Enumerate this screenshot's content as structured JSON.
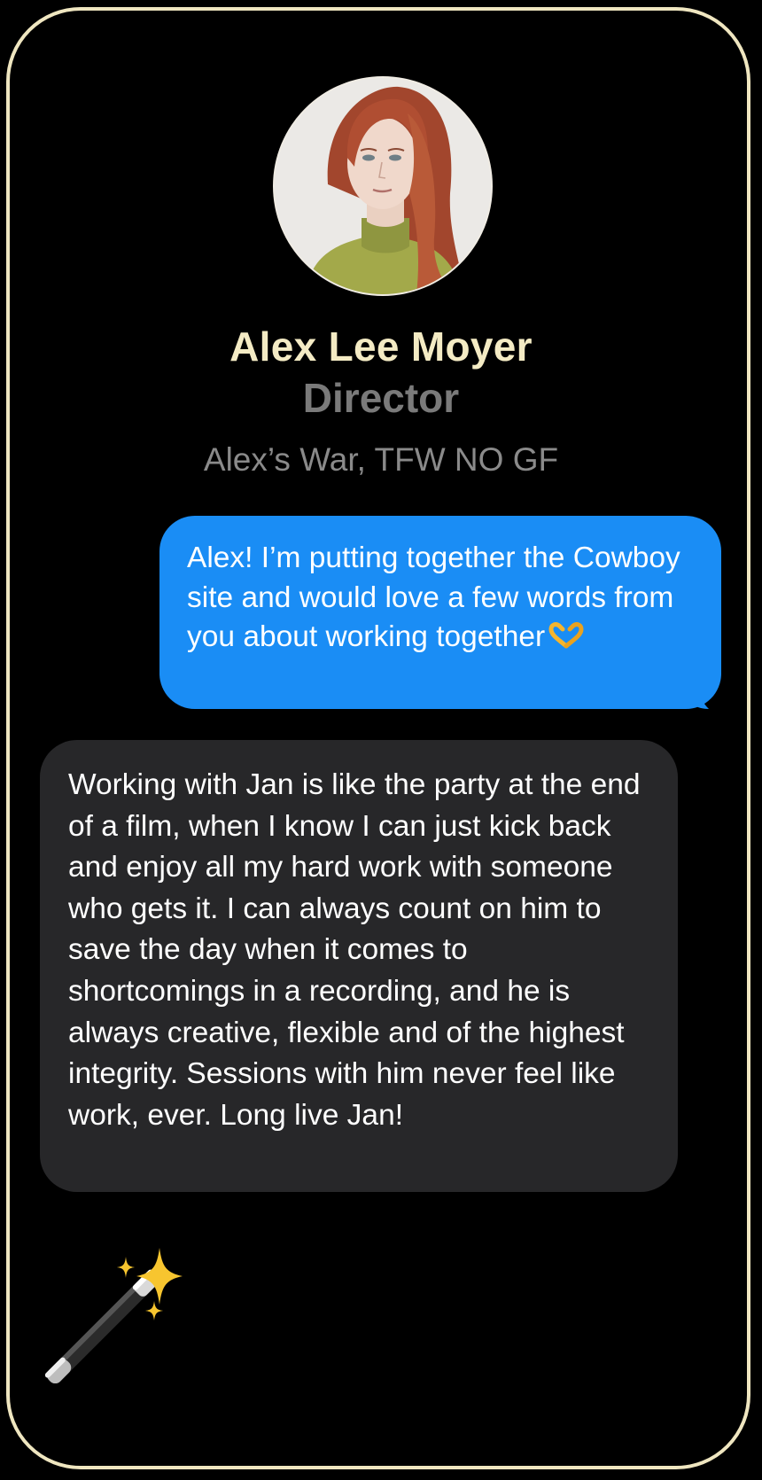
{
  "profile": {
    "name": "Alex Lee Moyer",
    "role": "Director",
    "credits": "Alex’s War, TFW NO GF"
  },
  "messages": {
    "outgoing": {
      "text": "Alex! I’m putting together the Cowboy site and would love a few words from you about working together",
      "emoji_icon": "heart-hands-icon"
    },
    "incoming": {
      "text": "Working with Jan is like the party at the end of a film, when I know I can just kick back and enjoy all my hard work with someone who gets it. I can always count on him to save the day when it comes to shortcomings in a recording, and he is always creative, flexible and of the highest integrity. Sessions with him never feel like work, ever. Long live Jan!"
    }
  },
  "decorations": {
    "wand_icon": "magic-wand-sparkles-icon"
  },
  "colors": {
    "background": "#000000",
    "card_border": "#efe6c0",
    "name": "#f4ebc4",
    "outgoing_bubble": "#1a8df5",
    "incoming_bubble": "#272729"
  }
}
